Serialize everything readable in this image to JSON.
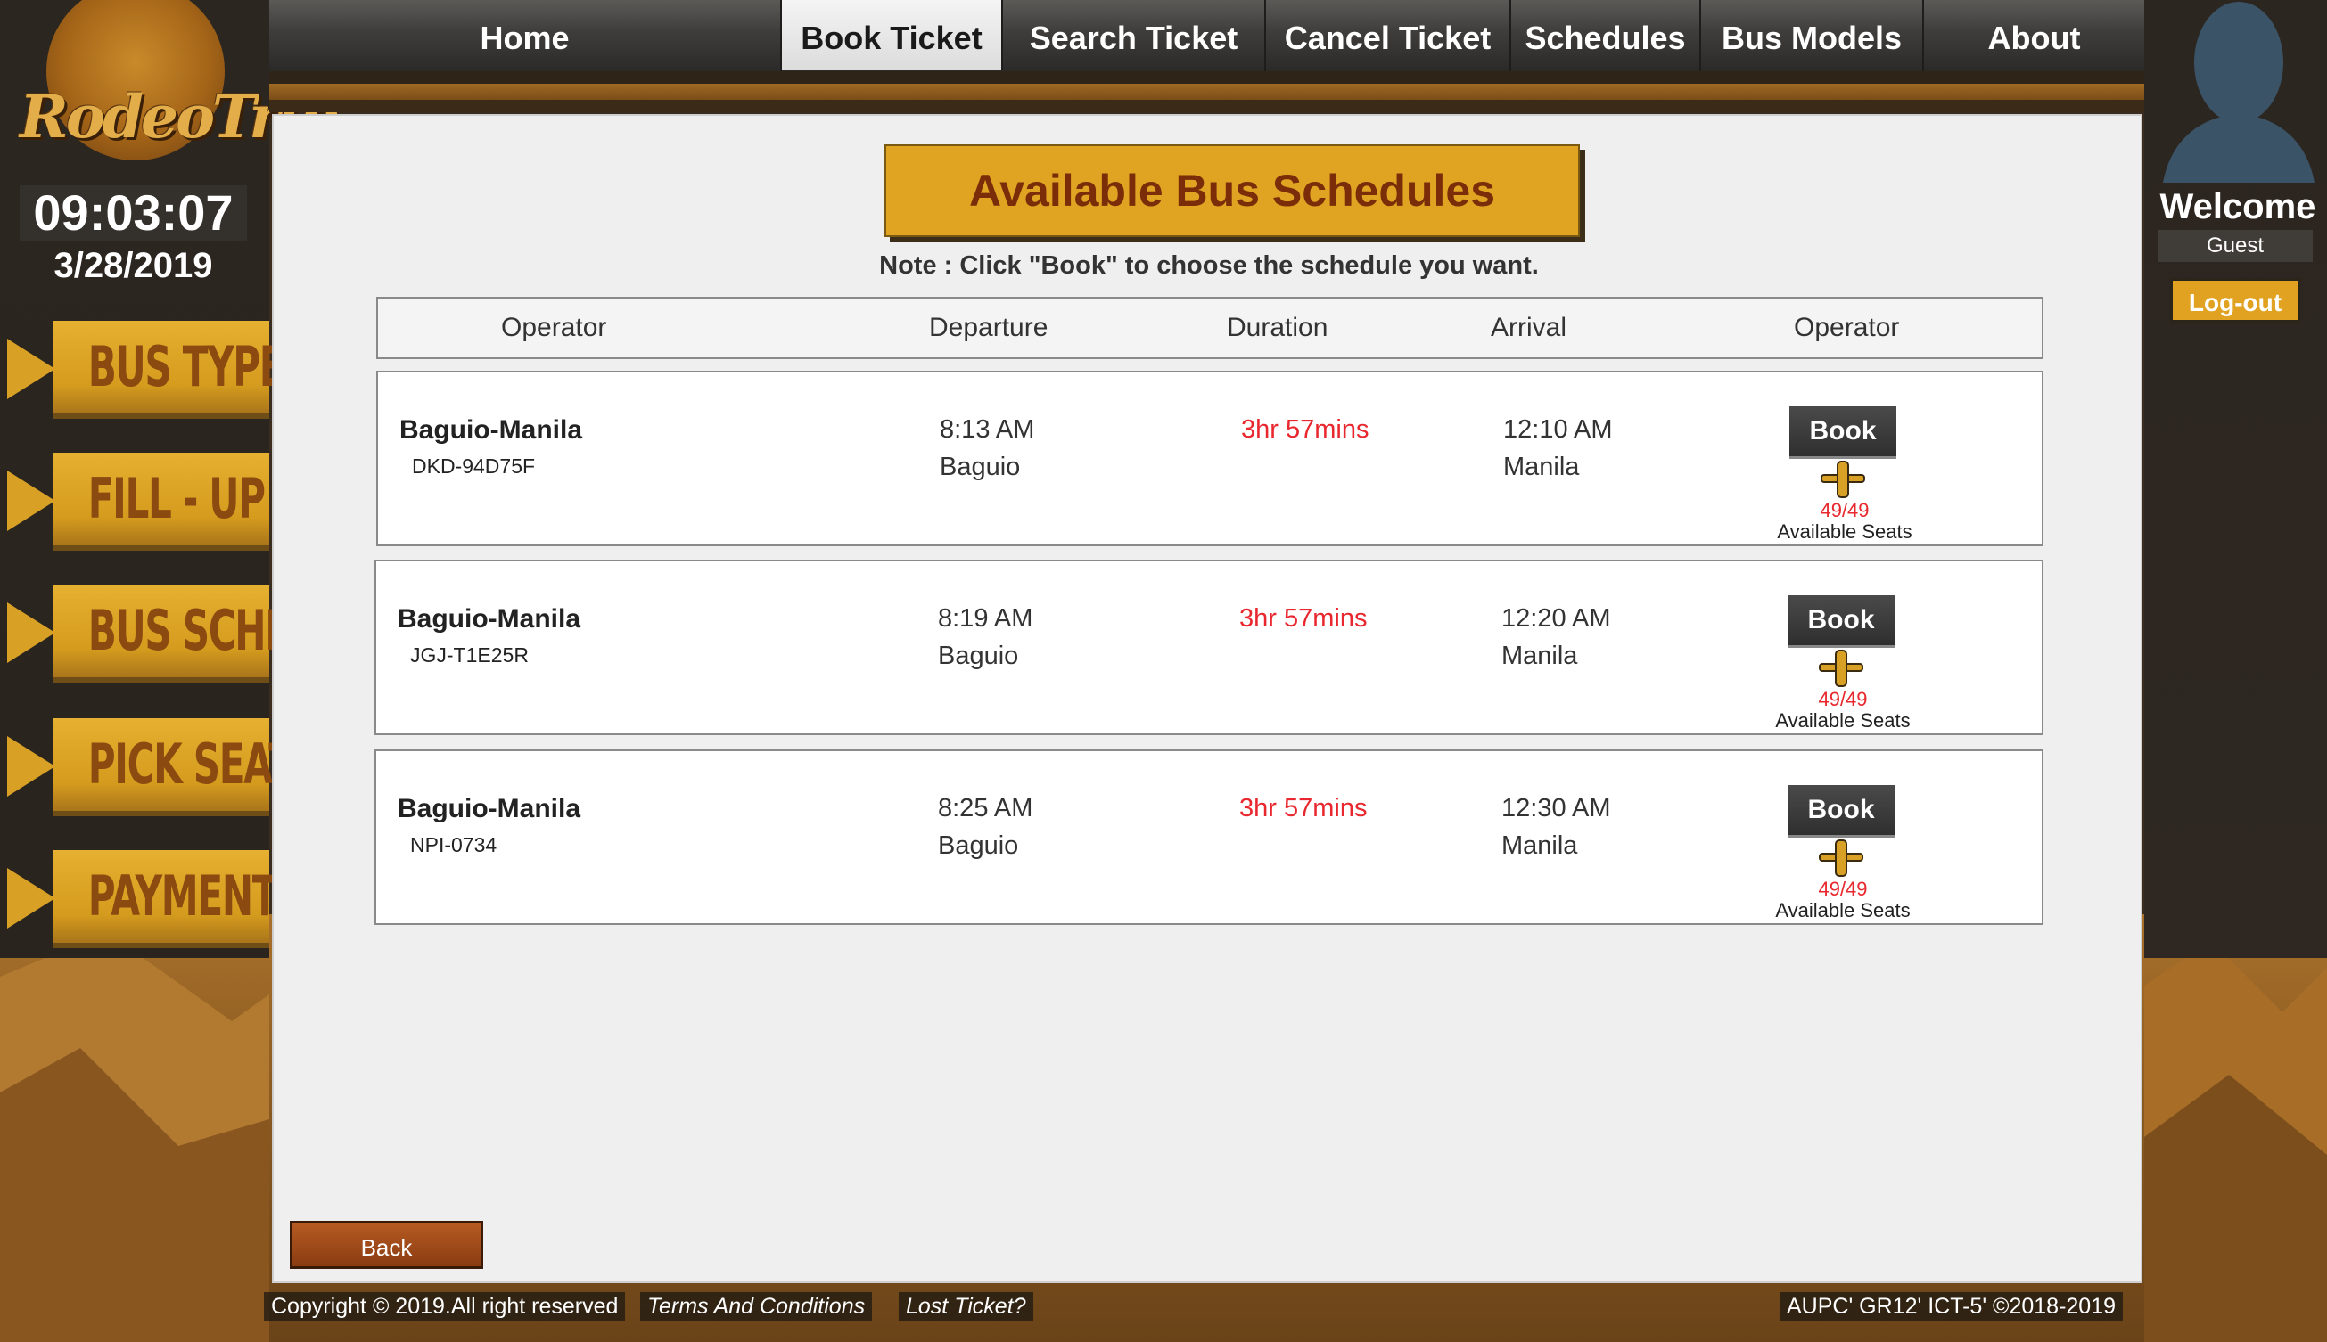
{
  "app": {
    "logo_text": "RodeoTrip",
    "clock": "09:03:07",
    "date": "3/28/2019"
  },
  "steps": [
    {
      "label": "BUS TYPE"
    },
    {
      "label": "FILL - UP"
    },
    {
      "label": "BUS SCHED."
    },
    {
      "label": "PICK SEATS"
    },
    {
      "label": "PAYMENT"
    }
  ],
  "nav": [
    {
      "label": "Home"
    },
    {
      "label": "Book Ticket"
    },
    {
      "label": "Search Ticket"
    },
    {
      "label": "Cancel Ticket"
    },
    {
      "label": "Schedules"
    },
    {
      "label": "Bus Models"
    },
    {
      "label": "About"
    }
  ],
  "user": {
    "welcome": "Welcome",
    "name": "Guest",
    "logout": "Log-out"
  },
  "page": {
    "title": "Available Bus Schedules",
    "note": "Note : Click \"Book\" to choose the schedule you want.",
    "columns": [
      "Operator",
      "Departure",
      "Duration",
      "Arrival",
      "Operator"
    ],
    "back": "Back"
  },
  "schedules": [
    {
      "route": "Baguio-Manila",
      "code": "DKD-94D75F",
      "dep_time": "8:13 AM",
      "dep_place": "Baguio",
      "duration": "3hr 57mins",
      "arr_time": "12:10 AM",
      "arr_place": "Manila",
      "book": "Book",
      "seats": "49/49",
      "seats_label": "Available Seats"
    },
    {
      "route": "Baguio-Manila",
      "code": "JGJ-T1E25R",
      "dep_time": "8:19 AM",
      "dep_place": "Baguio",
      "duration": "3hr 57mins",
      "arr_time": "12:20 AM",
      "arr_place": "Manila",
      "book": "Book",
      "seats": "49/49",
      "seats_label": "Available Seats"
    },
    {
      "route": "Baguio-Manila",
      "code": "NPI-0734",
      "dep_time": "8:25 AM",
      "dep_place": "Baguio",
      "duration": "3hr 57mins",
      "arr_time": "12:30 AM",
      "arr_place": "Manila",
      "book": "Book",
      "seats": "49/49",
      "seats_label": "Available Seats"
    }
  ],
  "footer": {
    "copyright": "Copyright © 2019.All right reserved",
    "terms": "Terms And Conditions",
    "lost": "Lost Ticket?",
    "credit": "AUPC' GR12'  ICT-5'  ©2018-2019"
  },
  "colors": {
    "accent": "#e1a422",
    "duration_red": "#e8282e",
    "step_indicator": "#5cd80e"
  }
}
